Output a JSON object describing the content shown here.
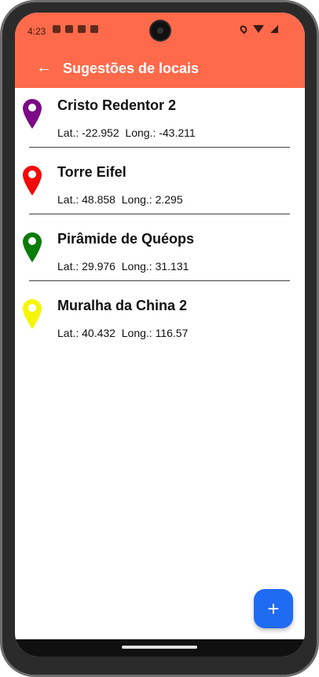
{
  "status_bar": {
    "time": "4:23"
  },
  "app_bar": {
    "back_icon": "arrow-left-icon",
    "title": "Sugestões de locais"
  },
  "places": [
    {
      "name": "Cristo Redentor 2",
      "lat_label": "Lat.:",
      "lat": "-22.952",
      "long_label": "Long.:",
      "long": "-43.211",
      "pin_color": "#7b0a86"
    },
    {
      "name": "Torre Eifel",
      "lat_label": "Lat.:",
      "lat": "48.858",
      "long_label": "Long.:",
      "long": "2.295",
      "pin_color": "#f20a0a"
    },
    {
      "name": "Pirâmide de Quéops",
      "lat_label": "Lat.:",
      "lat": "29.976",
      "long_label": "Long.:",
      "long": "31.131",
      "pin_color": "#0a7c0a"
    },
    {
      "name": "Muralha da China 2",
      "lat_label": "Lat.:",
      "lat": "40.432",
      "long_label": "Long.:",
      "long": "116.57",
      "pin_color": "#f5f50a"
    }
  ],
  "fab": {
    "icon": "plus-icon",
    "label": "+"
  },
  "colors": {
    "app_bar": "#ff6a4b",
    "fab": "#1f6cf3"
  }
}
